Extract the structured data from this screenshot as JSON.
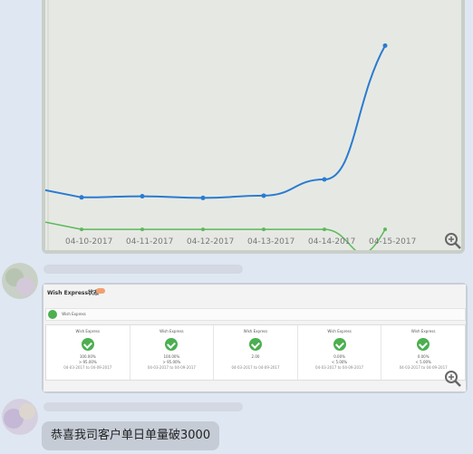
{
  "chat": {
    "msg1": {
      "chart_data": {
        "type": "line",
        "categories": [
          "04-10-2017",
          "04-11-2017",
          "04-12-2017",
          "04-13-2017",
          "04-14-2017",
          "04-15-2017"
        ],
        "series": [
          {
            "values": [
              60,
              62,
              59,
              63,
              92,
              330
            ],
            "color": "#2a7bd1"
          },
          {
            "values": [
              3,
              3,
              3,
              3,
              3,
              3
            ],
            "color": "#5cb85c"
          }
        ],
        "ylim": [
          0,
          350
        ],
        "grid": false,
        "legend": "none"
      }
    },
    "msg2": {
      "card": {
        "title": "Wish Express状态",
        "notice": "Wish Express",
        "metrics": [
          {
            "title": "Wish Express",
            "value": "100.00%",
            "target": "> 95.00%",
            "date": "04-03-2017 to 04-09-2017"
          },
          {
            "title": "Wish Express",
            "value": "100.00%",
            "target": "> 95.00%",
            "date": "04-03-2017 to 04-09-2017"
          },
          {
            "title": "Wish Express",
            "value": "2.00",
            "target": "",
            "date": "04-03-2017 to 04-09-2017"
          },
          {
            "title": "Wish Express",
            "value": "0.00%",
            "target": "< 5.00%",
            "date": "04-03-2017 to 04-09-2017"
          },
          {
            "title": "Wish Express",
            "value": "0.00%",
            "target": "< 5.00%",
            "date": "04-03-2017 to 04-09-2017"
          }
        ]
      }
    },
    "msg3": {
      "text": "恭喜我司客户单日单量破3000"
    }
  },
  "colors": {
    "success": "#4caf50",
    "line": "#2a7bd1",
    "page_bg": "#dfe7f2"
  },
  "icons": [
    "zoom-in-icon",
    "check-circle-icon"
  ]
}
